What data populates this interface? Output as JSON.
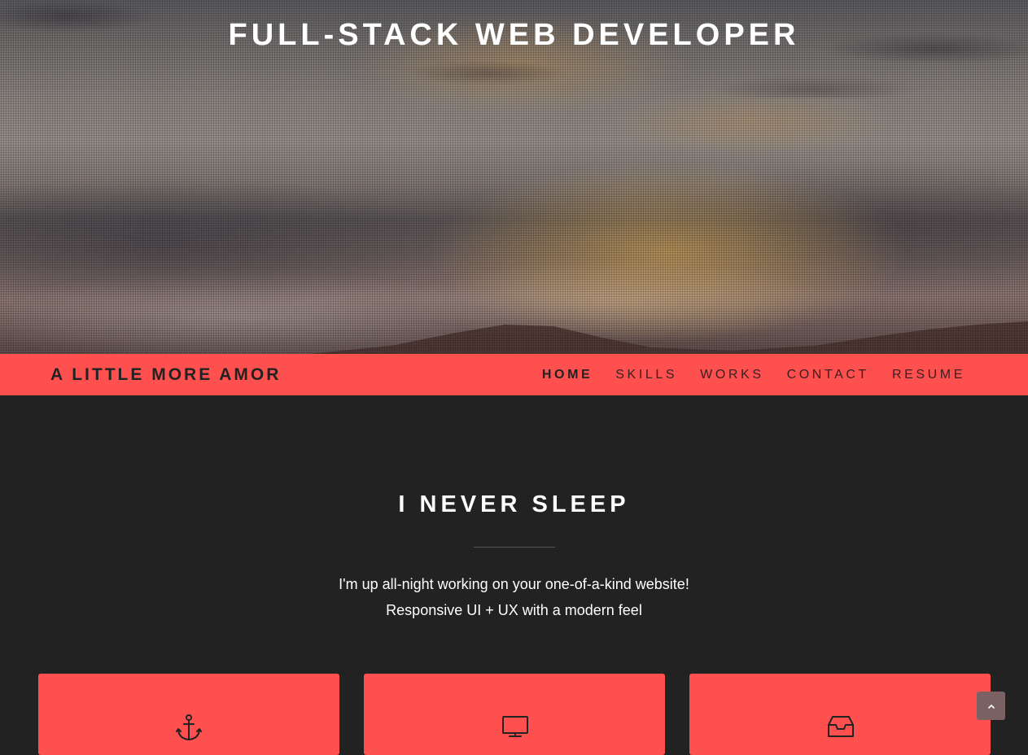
{
  "hero": {
    "title": "FULL-STACK WEB DEVELOPER"
  },
  "navbar": {
    "brand": "A LITTLE MORE AMOR",
    "links": [
      {
        "label": "HOME",
        "active": true
      },
      {
        "label": "SKILLS",
        "active": false
      },
      {
        "label": "WORKS",
        "active": false
      },
      {
        "label": "CONTACT",
        "active": false
      },
      {
        "label": "RESUME",
        "active": false
      }
    ]
  },
  "main": {
    "title": "I NEVER SLEEP",
    "tagline_line1": "I'm up all-night working on your one-of-a-kind website!",
    "tagline_line2": "Responsive UI + UX with a modern feel"
  },
  "cards": [
    {
      "icon": "anchor-icon"
    },
    {
      "icon": "monitor-icon"
    },
    {
      "icon": "inbox-icon"
    }
  ],
  "back_to_top": {
    "icon": "chevron-up-icon"
  },
  "colors": {
    "accent": "#ff5050",
    "background": "#222222",
    "text_light": "#ffffff",
    "text_dark": "#222222"
  }
}
